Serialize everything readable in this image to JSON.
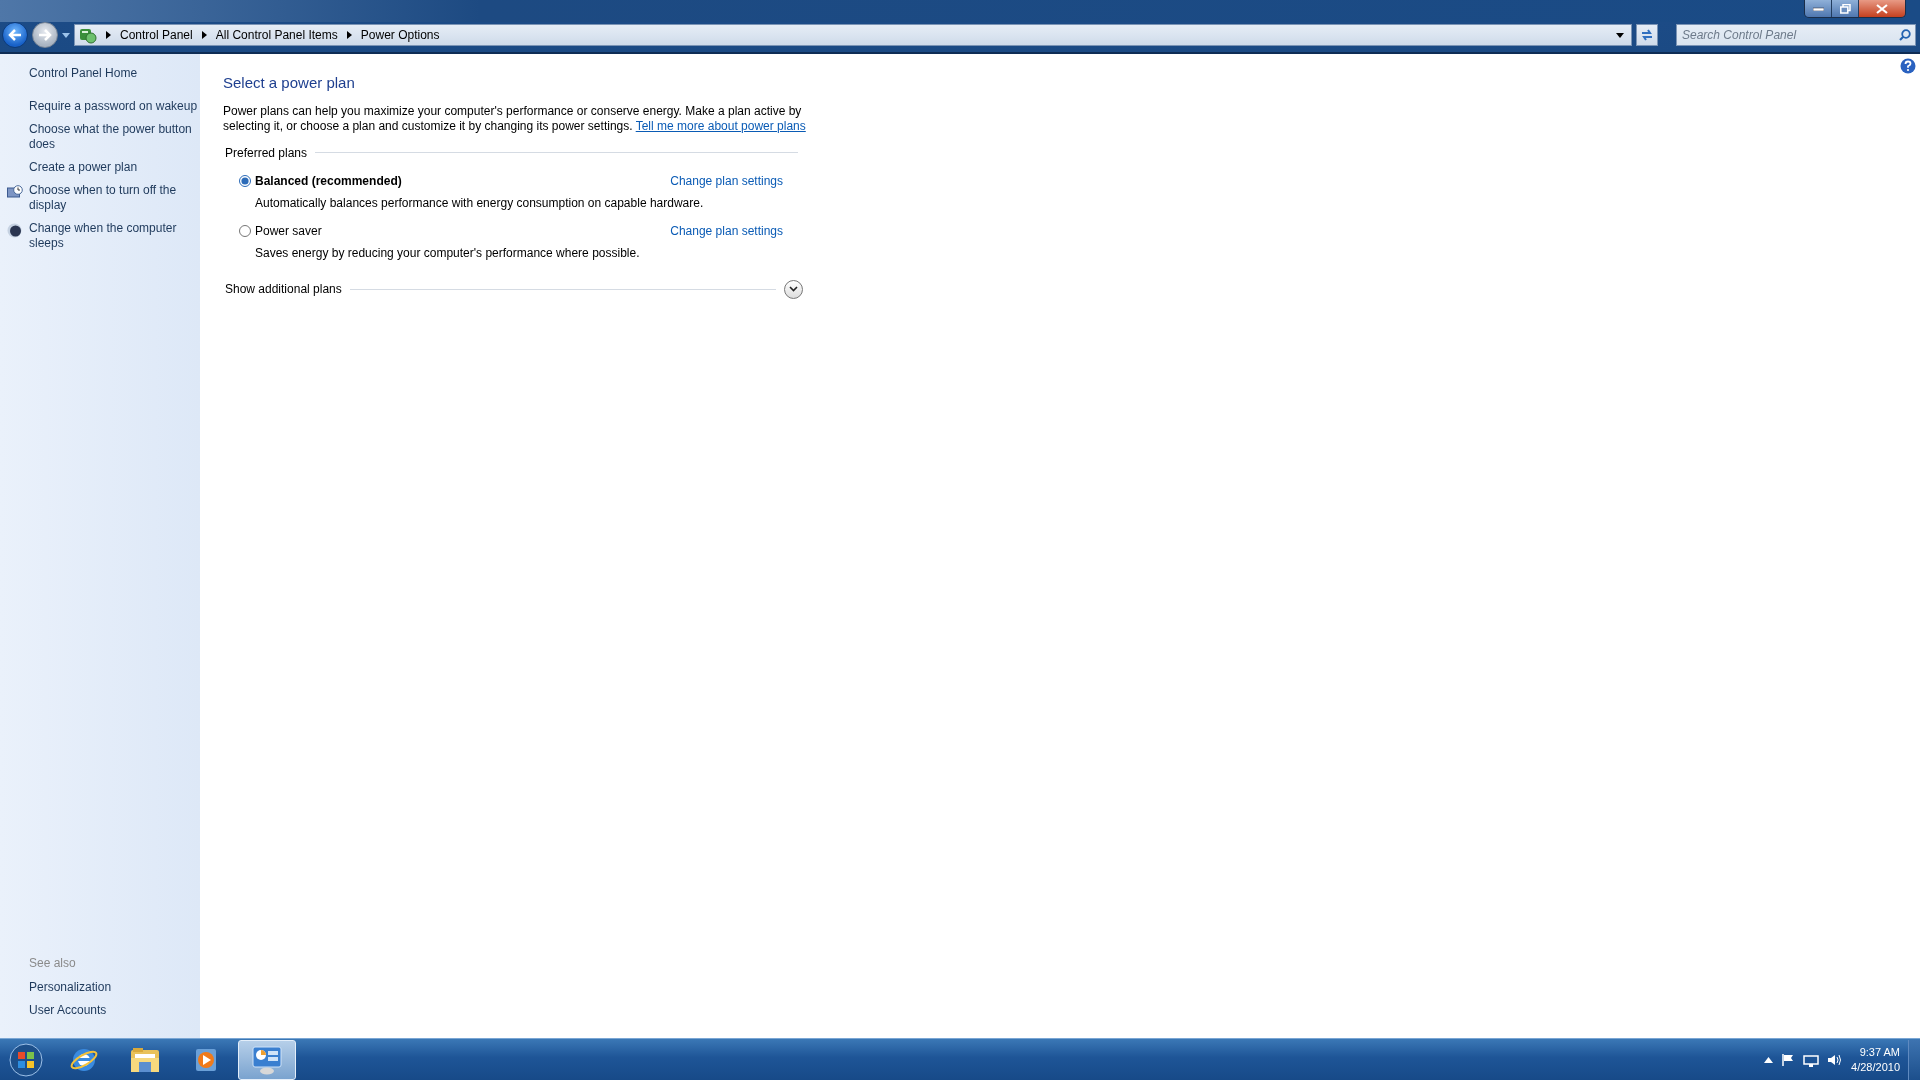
{
  "window": {
    "breadcrumb": [
      "Control Panel",
      "All Control Panel Items",
      "Power Options"
    ],
    "search": {
      "placeholder": "Search Control Panel"
    }
  },
  "sidebar": {
    "home": "Control Panel Home",
    "tasks": [
      {
        "label": "Require a password on wakeup",
        "kind": "plain"
      },
      {
        "label": "Choose what the power button does",
        "kind": "plain"
      },
      {
        "label": "Create a power plan",
        "kind": "plain"
      },
      {
        "label": "Choose when to turn off the display",
        "kind": "display"
      },
      {
        "label": "Change when the computer sleeps",
        "kind": "sleep"
      }
    ],
    "see_also": {
      "title": "See also",
      "items": [
        "Personalization",
        "User Accounts"
      ]
    }
  },
  "main": {
    "title": "Select a power plan",
    "intro": "Power plans can help you maximize your computer's performance or conserve energy. Make a plan active by selecting it, or choose a plan and customize it by changing its power settings.",
    "intro_link": "Tell me more about power plans",
    "section": "Preferred plans",
    "plans": [
      {
        "name": "Balanced (recommended)",
        "description": "Automatically balances performance with energy consumption on capable hardware.",
        "link": "Change plan settings",
        "selected": true
      },
      {
        "name": "Power saver",
        "description": "Saves energy by reducing your computer's performance where possible.",
        "link": "Change plan settings",
        "selected": false
      }
    ],
    "additional": {
      "label": "Show additional plans",
      "expanded": false
    }
  },
  "taskbar": {
    "apps": [
      {
        "kind": "browser",
        "active": false
      },
      {
        "kind": "folder",
        "active": false
      },
      {
        "kind": "media",
        "active": false
      },
      {
        "kind": "control-panel",
        "active": true
      }
    ],
    "time": "9:37 AM",
    "date": "4/28/2010"
  }
}
